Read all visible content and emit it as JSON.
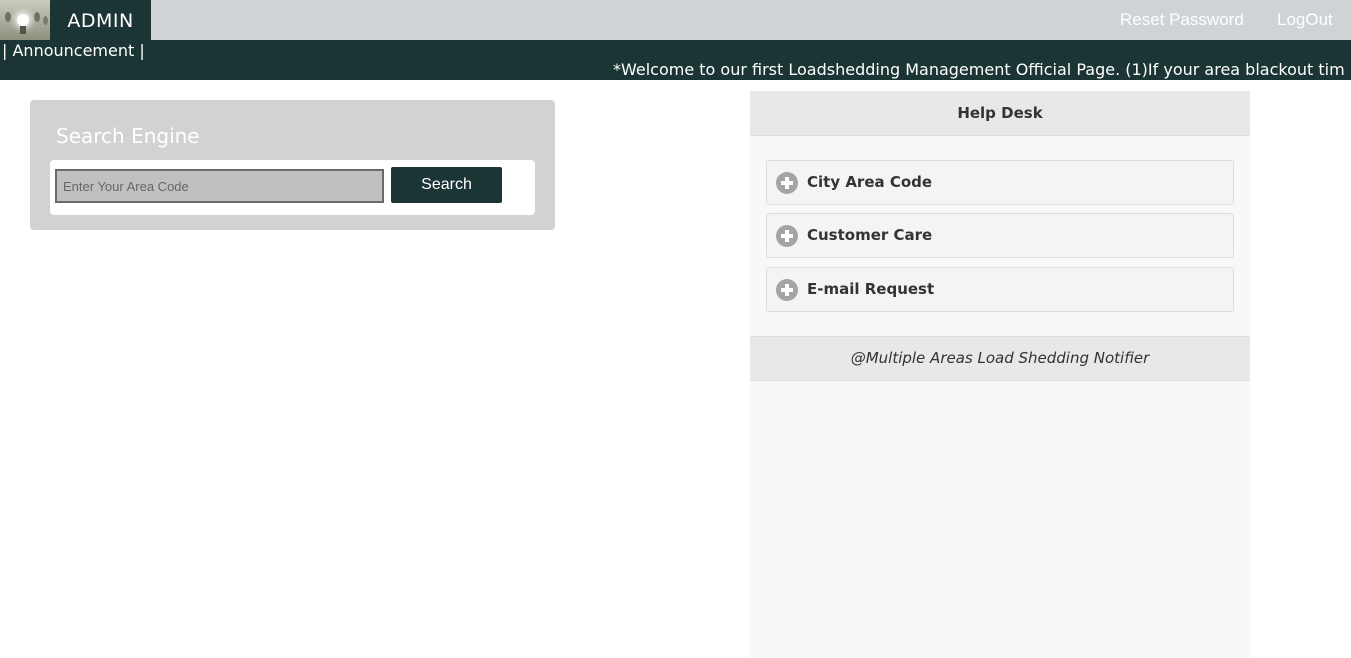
{
  "header": {
    "brand": "ADMIN",
    "reset_password": "Reset Password",
    "logout": "LogOut"
  },
  "announcement": {
    "label": "| Announcement |",
    "message": "*Welcome to our first Loadshedding Management Official Page. (1)If your area blackout tim"
  },
  "search": {
    "title": "Search Engine",
    "placeholder": "Enter Your Area Code",
    "button": "Search"
  },
  "helpdesk": {
    "title": "Help Desk",
    "items": [
      {
        "label": "City Area Code"
      },
      {
        "label": "Customer Care"
      },
      {
        "label": "E-mail Request"
      }
    ],
    "footer": "@Multiple Areas Load Shedding Notifier"
  },
  "colors": {
    "dark_teal": "#1b3535",
    "navbar_gray": "#cfd3d6",
    "panel_gray": "#d2d2d2"
  },
  "icons": {
    "logo": "lightbulb-logo",
    "accordion": "plus-circle-icon"
  }
}
